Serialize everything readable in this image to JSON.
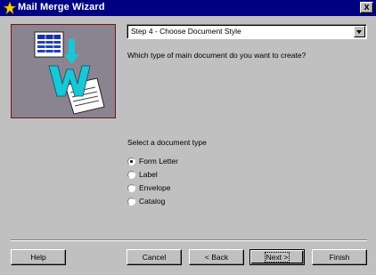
{
  "window": {
    "title": "Mail Merge Wizard",
    "close_symbol": "x"
  },
  "wizard": {
    "step_selected": "Step 4 - Choose Document Style",
    "question": "Which type of main document do you want to create?",
    "doc_type_label": "Select a document type",
    "options": [
      {
        "label": "Form Letter",
        "checked": true
      },
      {
        "label": "Label",
        "checked": false
      },
      {
        "label": "Envelope",
        "checked": false
      },
      {
        "label": "Catalog",
        "checked": false
      }
    ]
  },
  "buttons": {
    "help": "Help",
    "cancel": "Cancel",
    "back": "< Back",
    "next": "Next >",
    "finish": "Finish"
  },
  "colors": {
    "titlebar": "#000082",
    "window_bg": "#c0c0c0",
    "image_panel_bg": "#8a8490",
    "image_panel_border": "#7a1020"
  },
  "icons": [
    "wizard-title-icon",
    "mail-merge-illustration",
    "dropdown-arrow-icon"
  ]
}
